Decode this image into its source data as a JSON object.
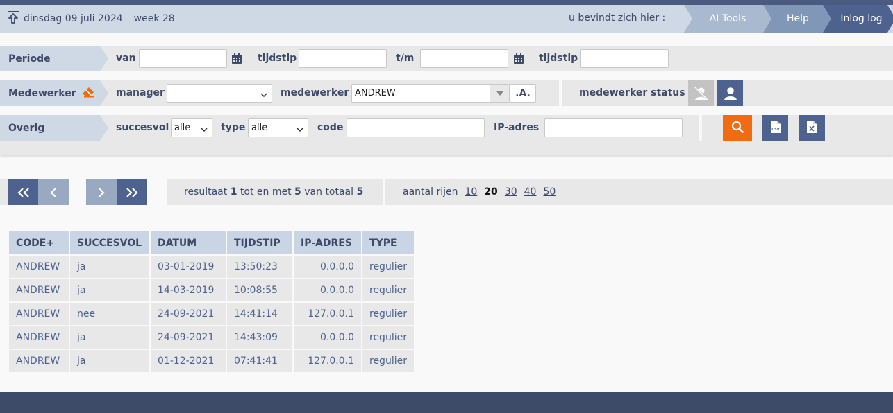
{
  "header": {
    "date": "dinsdag 09 juli 2024",
    "week": "week 28",
    "location_label": "u bevindt zich hier :",
    "breadcrumbs": [
      "AI Tools",
      "Help",
      "Inlog log"
    ]
  },
  "filters": {
    "periode": {
      "label": "Periode",
      "van_label": "van",
      "tijdstip_label": "tijdstip",
      "tm_label": "t/m",
      "tijdstip2_label": "tijdstip",
      "van_value": "",
      "tijdstip_value": "",
      "tm_value": "",
      "tijdstip2_value": ""
    },
    "medewerker": {
      "label": "Medewerker",
      "manager_label": "manager",
      "manager_value": "",
      "medewerker_label": "medewerker",
      "medewerker_value": "ANDREW",
      "wildcard_label": ".A.",
      "status_label": "medewerker status"
    },
    "overig": {
      "label": "Overig",
      "succesvol_label": "succesvol",
      "succesvol_value": "alle",
      "type_label": "type",
      "type_value": "alle",
      "code_label": "code",
      "code_value": "",
      "ip_label": "IP-adres",
      "ip_value": ""
    }
  },
  "pager": {
    "result_prefix": "resultaat",
    "from": "1",
    "mid1": "tot en met",
    "to": "5",
    "mid2": "van totaal",
    "total": "5",
    "rows_label": "aantal rijen",
    "row_options": [
      "10",
      "20",
      "30",
      "40",
      "50"
    ],
    "selected_rows": "20"
  },
  "table": {
    "headers": [
      "CODE+",
      "SUCCESVOL",
      "DATUM",
      "TIJDSTIP",
      "IP-ADRES",
      "TYPE"
    ],
    "rows": [
      [
        "ANDREW",
        "ja",
        "03-01-2019",
        "13:50:23",
        "0.0.0.0",
        "regulier"
      ],
      [
        "ANDREW",
        "ja",
        "14-03-2019",
        "10:08:55",
        "0.0.0.0",
        "regulier"
      ],
      [
        "ANDREW",
        "nee",
        "24-09-2021",
        "14:41:14",
        "127.0.0.1",
        "regulier"
      ],
      [
        "ANDREW",
        "ja",
        "24-09-2021",
        "14:43:09",
        "0.0.0.0",
        "regulier"
      ],
      [
        "ANDREW",
        "ja",
        "01-12-2021",
        "07:41:41",
        "127.0.0.1",
        "regulier"
      ]
    ]
  },
  "colors": {
    "accent": "#4e6290",
    "search_button": "#f26a12",
    "header_bg": "#cfd8e5",
    "footer": "#3d4a68"
  },
  "icons": {
    "home": "upload-home-icon",
    "calendar": "calendar-icon",
    "eraser": "eraser-icon",
    "inactive_user": "user-slash-icon",
    "active_user": "user-icon",
    "search": "search-icon",
    "csv": "csv-file-icon",
    "excel": "excel-file-icon"
  }
}
